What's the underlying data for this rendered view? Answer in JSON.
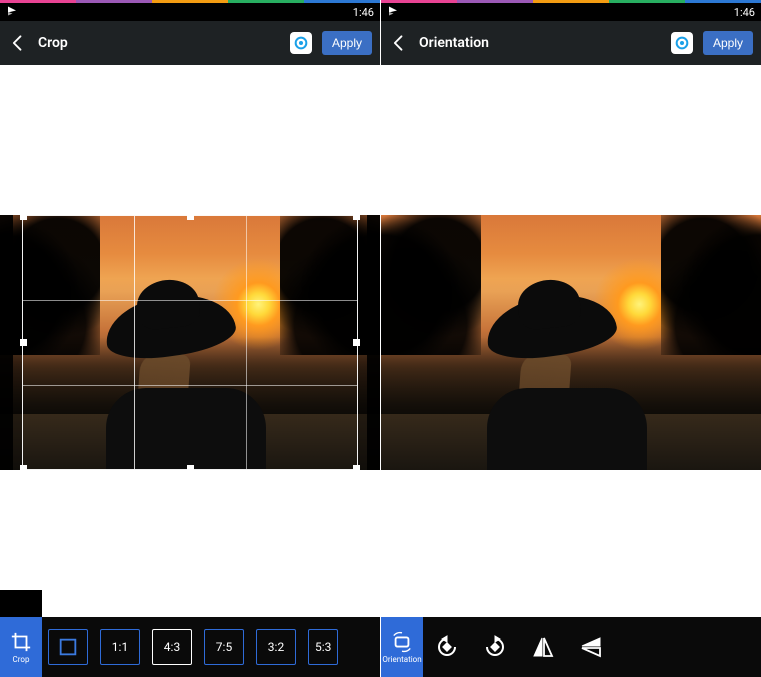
{
  "status": {
    "time": "1:46"
  },
  "colors": {
    "accent": "#2f6bd8",
    "header": "#1e2224"
  },
  "left": {
    "header": {
      "title": "Crop",
      "apply": "Apply"
    },
    "mode": {
      "label": "Crop"
    },
    "ratios": [
      "1:1",
      "4:3",
      "7:5",
      "3:2",
      "5:3"
    ],
    "active_ratio": "4:3"
  },
  "right": {
    "header": {
      "title": "Orientation",
      "apply": "Apply"
    },
    "mode": {
      "label": "Orientation"
    }
  }
}
